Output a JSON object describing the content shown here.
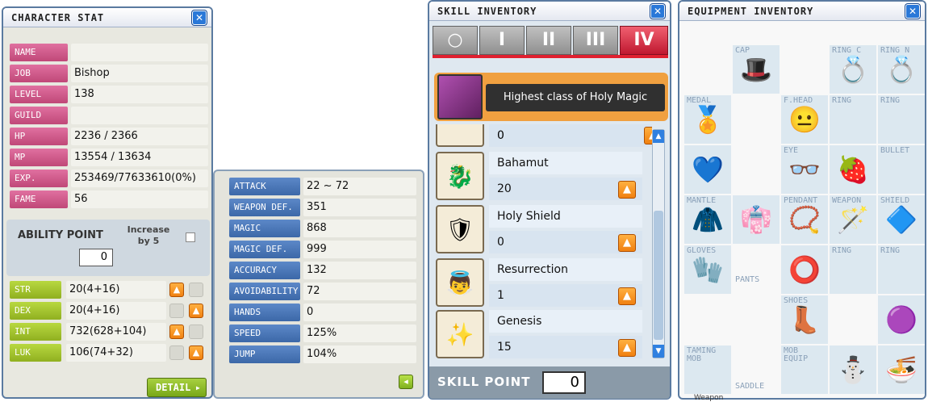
{
  "char_stat": {
    "title": "CHARACTER STAT",
    "rows": [
      {
        "label": "NAME",
        "value": ""
      },
      {
        "label": "JOB",
        "value": "Bishop"
      },
      {
        "label": "LEVEL",
        "value": "138"
      },
      {
        "label": "GUILD",
        "value": ""
      },
      {
        "label": "HP",
        "value": "2236 / 2366"
      },
      {
        "label": "MP",
        "value": "13554 / 13634"
      },
      {
        "label": "EXP.",
        "value": "253469/77633610(0%)"
      },
      {
        "label": "FAME",
        "value": "56"
      }
    ],
    "ability_point_label": "ABILITY POINT",
    "ability_point_value": "0",
    "increase_label": "Increase by 5",
    "attrs": [
      {
        "label": "STR",
        "value": "20(4+16)"
      },
      {
        "label": "DEX",
        "value": "20(4+16)"
      },
      {
        "label": "INT",
        "value": "732(628+104)"
      },
      {
        "label": "LUK",
        "value": "106(74+32)"
      }
    ],
    "detail_label": "DETAIL"
  },
  "detail_stat": {
    "rows": [
      {
        "label": "ATTACK",
        "value": "22 ~ 72"
      },
      {
        "label": "WEAPON DEF.",
        "value": "351"
      },
      {
        "label": "MAGIC",
        "value": "868"
      },
      {
        "label": "MAGIC DEF.",
        "value": "999"
      },
      {
        "label": "ACCURACY",
        "value": "132"
      },
      {
        "label": "AVOIDABILITY",
        "value": "72"
      },
      {
        "label": "HANDS",
        "value": "0"
      },
      {
        "label": "SPEED",
        "value": "125%"
      },
      {
        "label": "JUMP",
        "value": "104%"
      }
    ]
  },
  "skill_inv": {
    "title": "SKILL INVENTORY",
    "tabs": [
      "○",
      "I",
      "II",
      "III",
      "IV"
    ],
    "header_text": "Highest class of Holy Magic",
    "partial_level": "0",
    "skills": [
      {
        "name": "Bahamut",
        "level": "20",
        "icon": "🐉"
      },
      {
        "name": "Holy Shield",
        "level": "0",
        "icon": "🛡"
      },
      {
        "name": "Resurrection",
        "level": "1",
        "icon": "👼"
      },
      {
        "name": "Genesis",
        "level": "15",
        "icon": "✨"
      }
    ],
    "skill_point_label": "SKILL POINT",
    "skill_point_value": "0"
  },
  "equip_inv": {
    "title": "EQUIPMENT INVENTORY",
    "slot_labels": {
      "cap": "CAP",
      "ring_c": "RING C",
      "ring_n": "RING N",
      "medal": "MEDAL",
      "forehead": "F.HEAD",
      "ring1": "RING",
      "ring2": "RING",
      "eye": "EYE",
      "bullet": "BULLET",
      "mantle": "MANTLE",
      "pendant": "PENDANT",
      "weapon": "WEAPON",
      "shield": "SHIELD",
      "gloves": "GLOVES",
      "ring3": "RING",
      "ring4": "RING",
      "pants": "PANTS",
      "shoes": "SHOES",
      "taming_mob": "TAMING MOB",
      "mob_equip": "MOB EQUIP",
      "saddle": "SADDLE"
    },
    "footer_partial": "Weapon"
  }
}
